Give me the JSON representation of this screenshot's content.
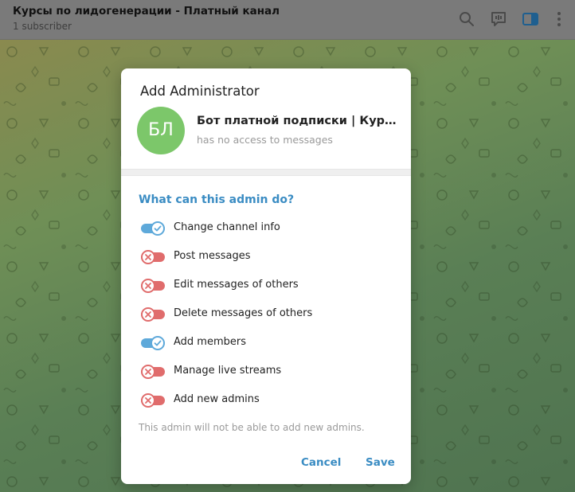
{
  "header": {
    "title": "Курсы по лидогенерации - Платный канал",
    "subtitle": "1 subscriber",
    "icons": [
      "search-icon",
      "live-stream-icon",
      "sidebar-toggle-icon",
      "more-vertical-icon"
    ]
  },
  "dialog": {
    "title": "Add Administrator",
    "avatar_initials": "БЛ",
    "bot_name": "Бот платной подписки | Курс лидогенерации",
    "bot_status": "has no access to messages",
    "section_title": "What can this admin do?",
    "permissions": [
      {
        "label": "Change channel info",
        "enabled": true
      },
      {
        "label": "Post messages",
        "enabled": false
      },
      {
        "label": "Edit messages of others",
        "enabled": false
      },
      {
        "label": "Delete messages of others",
        "enabled": false
      },
      {
        "label": "Add members",
        "enabled": true
      },
      {
        "label": "Manage live streams",
        "enabled": false
      },
      {
        "label": "Add new admins",
        "enabled": false
      }
    ],
    "note": "This admin will not be able to add new admins.",
    "cancel_label": "Cancel",
    "save_label": "Save"
  },
  "colors": {
    "accent": "#3a8cc3",
    "toggle_on": "#5ea9da",
    "toggle_off": "#e06c6c",
    "avatar": "#7cc76a"
  }
}
